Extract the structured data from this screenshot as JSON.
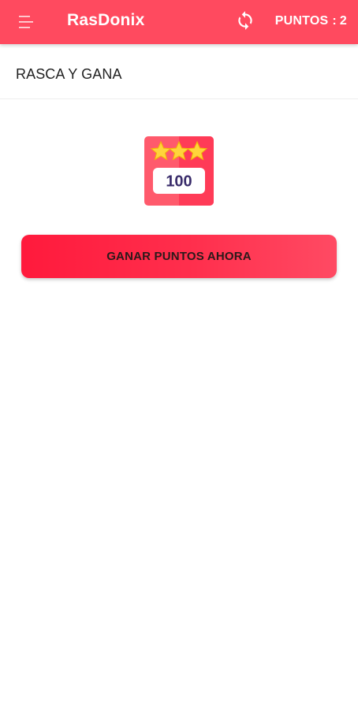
{
  "app": {
    "title": "RasDonix",
    "brand_color": "#ff4a5f"
  },
  "header": {
    "menu_icon": "hamburger-menu-icon",
    "refresh_icon": "refresh-icon",
    "points_label": "PUNTOS",
    "points_separator": ":",
    "points_value": "2"
  },
  "section": {
    "title": "RASCA Y GANA"
  },
  "badge": {
    "icon": "stars-badge-icon",
    "value": "100",
    "stars": 3
  },
  "cta": {
    "label": "GANAR PUNTOS AHORA"
  }
}
